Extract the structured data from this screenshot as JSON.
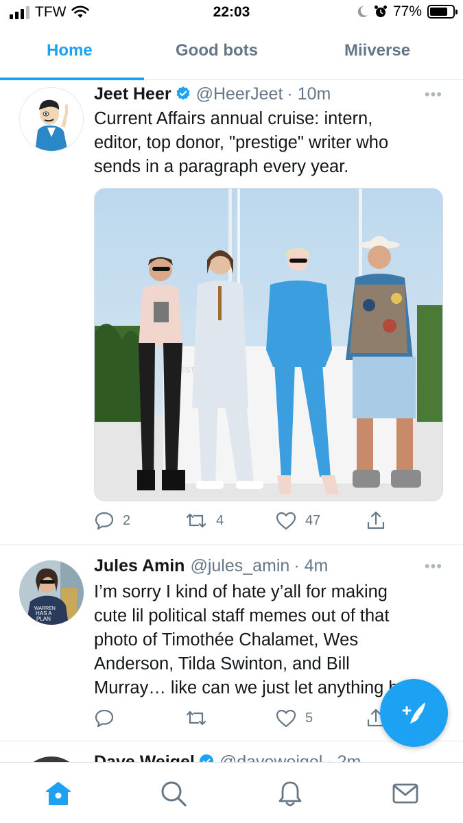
{
  "status_bar": {
    "carrier": "TFW",
    "time": "22:03",
    "battery_percent_label": "77%",
    "battery_level": 0.77
  },
  "tabs": [
    {
      "label": "Home",
      "active": true
    },
    {
      "label": "Good bots",
      "active": false
    },
    {
      "label": "Miiverse",
      "active": false
    }
  ],
  "tweets": [
    {
      "name": "Jeet Heer",
      "verified": true,
      "handle": "@HeerJeet",
      "time": "· 10m",
      "more": "•••",
      "text_lines": [
        "Current Affairs annual cruise: intern,",
        "editor, top donor, \"prestige\" writer who",
        "sends in a paragraph every year."
      ],
      "actions": {
        "replies": "2",
        "retweets": "4",
        "likes": "47"
      }
    },
    {
      "name": "Jules Amin",
      "verified": false,
      "handle": "@jules_amin",
      "time": "· 4m",
      "more": "•••",
      "text_lines": [
        "I’m sorry I kind of hate y’all for making",
        "cute lil political staff memes out of that",
        "photo of Timothée Chalamet, Wes",
        "Anderson, Tilda Swinton, and Bill",
        "Murray… like can we just let anything be?"
      ],
      "actions": {
        "replies": "",
        "retweets": "",
        "likes": "5"
      }
    },
    {
      "name": "Dave Weigel",
      "verified": true,
      "handle": "@daveweigel",
      "time": "· 2m"
    }
  ],
  "icons": {
    "nav": [
      "home-icon",
      "search-icon",
      "bell-icon",
      "mail-icon"
    ],
    "fab": "compose-icon"
  },
  "colors": {
    "accent": "#1da1f2",
    "secondary_text": "#657786",
    "primary_text": "#14171a",
    "divider": "#e1e8ed"
  }
}
